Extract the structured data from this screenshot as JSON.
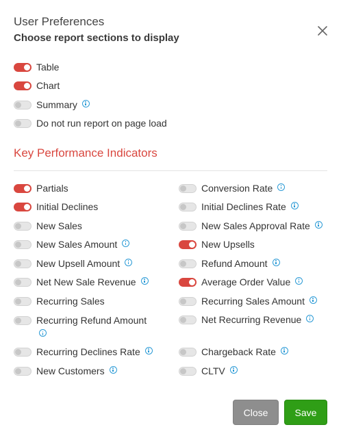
{
  "dialog": {
    "title": "User Preferences",
    "subtitle": "Choose report sections to display"
  },
  "sections": [
    {
      "label": "Table",
      "on": true,
      "info": false
    },
    {
      "label": "Chart",
      "on": true,
      "info": false
    },
    {
      "label": "Summary",
      "on": false,
      "info": true
    },
    {
      "label": "Do not run report on page load",
      "on": false,
      "info": false
    }
  ],
  "kpi": {
    "heading": "Key Performance Indicators",
    "left": [
      {
        "label": "Partials",
        "on": true,
        "info": false
      },
      {
        "label": "Initial Declines",
        "on": true,
        "info": false
      },
      {
        "label": "New Sales",
        "on": false,
        "info": false
      },
      {
        "label": "New Sales Amount",
        "on": false,
        "info": true
      },
      {
        "label": "New Upsell Amount",
        "on": false,
        "info": true
      },
      {
        "label": "Net New Sale Revenue",
        "on": false,
        "info": true
      },
      {
        "label": "Recurring Sales",
        "on": false,
        "info": false
      },
      {
        "label": "Recurring Refund Amount",
        "on": false,
        "info": true
      },
      {
        "label": "Recurring Declines Rate",
        "on": false,
        "info": true
      },
      {
        "label": "New Customers",
        "on": false,
        "info": true
      }
    ],
    "right": [
      {
        "label": "Conversion Rate",
        "on": false,
        "info": true
      },
      {
        "label": "Initial Declines Rate",
        "on": false,
        "info": true
      },
      {
        "label": "New Sales Approval Rate",
        "on": false,
        "info": true
      },
      {
        "label": "New Upsells",
        "on": true,
        "info": false
      },
      {
        "label": "Refund Amount",
        "on": false,
        "info": true
      },
      {
        "label": "Average Order Value",
        "on": true,
        "info": true
      },
      {
        "label": "Recurring Sales Amount",
        "on": false,
        "info": true
      },
      {
        "label": "Net Recurring Revenue",
        "on": false,
        "info": true
      },
      {
        "label": "Chargeback Rate",
        "on": false,
        "info": true
      },
      {
        "label": "CLTV",
        "on": false,
        "info": true
      }
    ]
  },
  "buttons": {
    "close": "Close",
    "save": "Save"
  },
  "colors": {
    "accent": "#d9473f",
    "save": "#2f9e16",
    "close": "#8e8e8e",
    "info": "#2a9ad6"
  }
}
